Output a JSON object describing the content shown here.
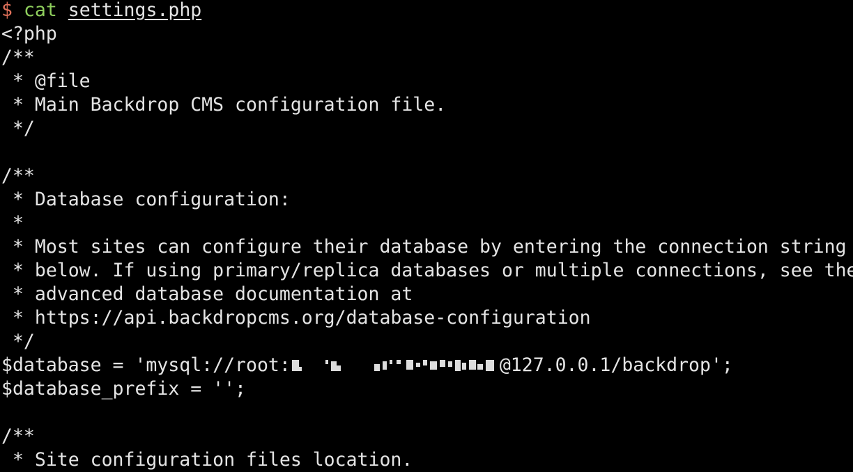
{
  "terminal": {
    "prompt": {
      "symbol": "$",
      "command": "cat",
      "argument": "settings.php"
    },
    "lines": [
      "<?php",
      "/**",
      " * @file",
      " * Main Backdrop CMS configuration file.",
      " */",
      "",
      "/**",
      " * Database configuration:",
      " *",
      " * Most sites can configure their database by entering the connection string",
      " * below. If using primary/replica databases or multiple connections, see the",
      " * advanced database documentation at",
      " * https://api.backdropcms.org/database-configuration",
      " */"
    ],
    "database_line": {
      "prefix": "$database = 'mysql://root:",
      "suffix": "@127.0.0.1/backdrop';"
    },
    "lines_after": [
      "$database_prefix = '';",
      "",
      "/**",
      " * Site configuration files location."
    ],
    "colors": {
      "background": "#000000",
      "text": "#e4e4e4",
      "prompt_symbol": "#e0705a",
      "command": "#8fcf5d"
    }
  }
}
